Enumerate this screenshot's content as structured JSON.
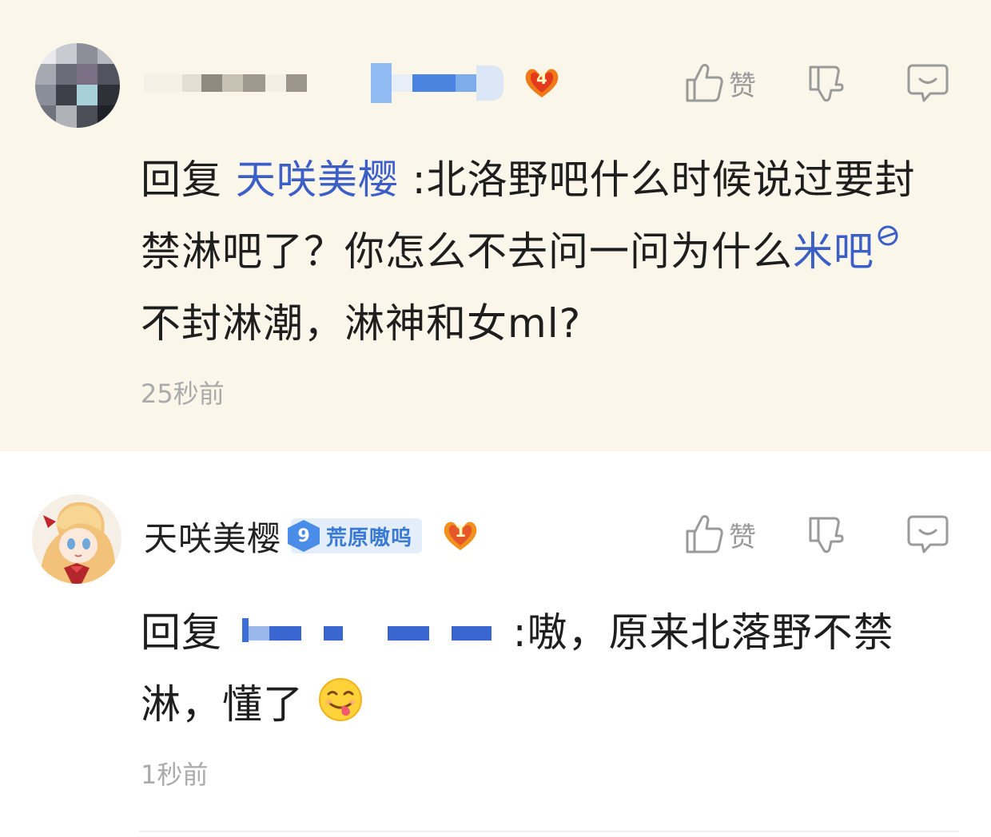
{
  "comments": [
    {
      "reply_prefix": "回复 ",
      "reply_to": "天咲美樱",
      "text_part1": " :北洛野吧什么时候说过要封禁淋吧了？你怎么不去问一问为什么",
      "linked_forum": "米吧",
      "text_part2": "不封淋潮，淋神和女ml?",
      "time": "25秒前",
      "like_label": "赞",
      "fan_level": "4",
      "username_blurred": true
    },
    {
      "username": "天咲美樱",
      "level_num": "9",
      "level_title": "荒原嗷呜",
      "fan_level": "1",
      "reply_prefix": "回复 ",
      "text": " :嗷，原来北落野不禁淋，懂了",
      "time": "1秒前",
      "like_label": "赞"
    }
  ],
  "colors": {
    "highlight_bg": "#fbf6ea",
    "link": "#3b5fc7",
    "muted": "#9a9a9a",
    "level_badge": "#4a8de8"
  },
  "icons": [
    "thumbs-up-icon",
    "thumbs-down-icon",
    "reply-bubble-icon",
    "fan-level-badge-icon",
    "tongue-out-emoji-icon"
  ]
}
